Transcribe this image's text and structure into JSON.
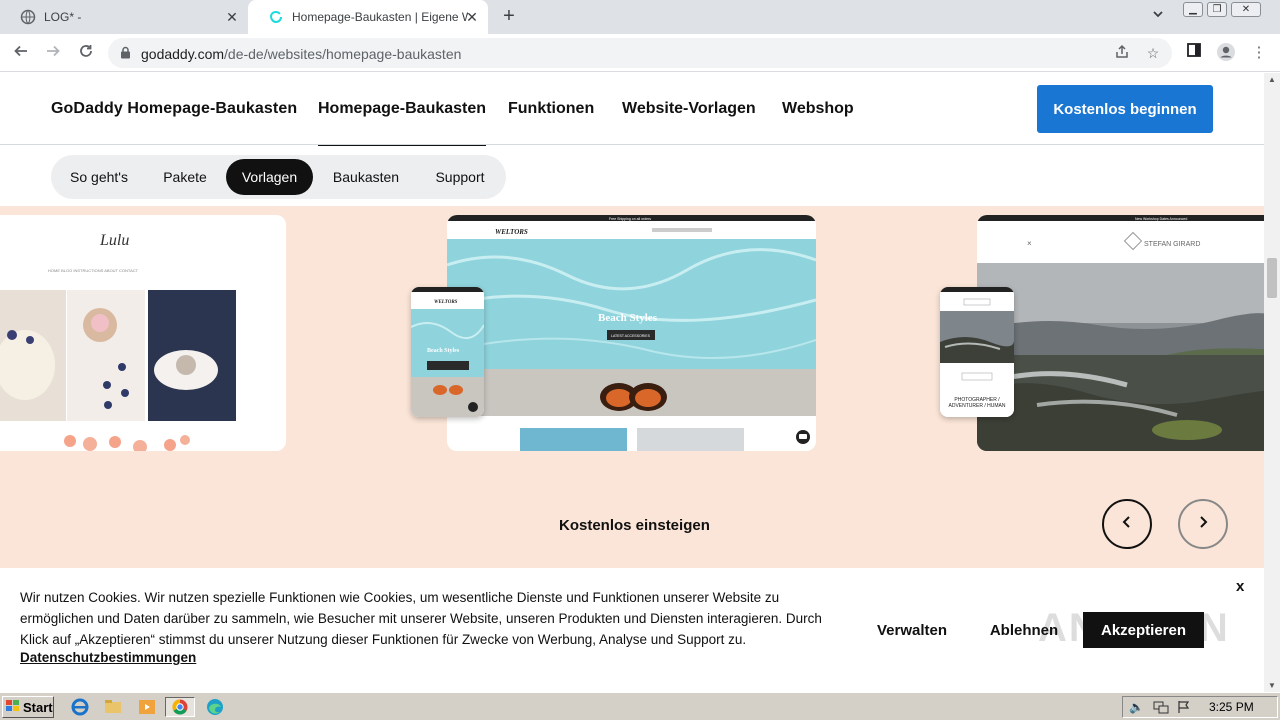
{
  "browser": {
    "tabs": [
      {
        "title": "LOG* -"
      },
      {
        "title": "Homepage-Baukasten | Eigene Website erstellen"
      }
    ],
    "url_host": "godaddy.com",
    "url_path": "/de-de/websites/homepage-baukasten"
  },
  "nav": {
    "brand": "GoDaddy Homepage-Baukasten",
    "links": [
      "Homepage-Baukasten",
      "Funktionen",
      "Website-Vorlagen",
      "Webshop"
    ],
    "cta": "Kostenlos beginnen"
  },
  "subnav": [
    "So geht's",
    "Pakete",
    "Vorlagen",
    "Baukasten",
    "Support"
  ],
  "hero": {
    "templates": {
      "lulu_logo": "Lulu",
      "lulu_menu": "HOME   BLOG   INSTRUCTIONS   ABOUT   CONTACT",
      "beach_logo": "WELTORS",
      "beach_headline": "Beach Styles",
      "beach_button": "LATEST ACCESSORIES",
      "beach_bar": "Free Shipping on all orders",
      "photo_name": "STEFAN GIRARD",
      "photo_bar": "New Workshop Dates Announced",
      "photo_tagline": "PHOTOGRAPHER / ADVENTURER / HUMAN"
    },
    "footer_label": "Kostenlos einsteigen"
  },
  "cookie": {
    "text": "Wir nutzen Cookies. Wir nutzen spezielle Funktionen wie Cookies, um wesentliche Dienste und Funktionen unserer Website zu ermöglichen und Daten darüber zu sammeln, wie Besucher mit unserer Website, unseren Produkten und Diensten interagieren. Durch Klick auf „Akzeptieren“ stimmst du unserer Nutzung dieser Funktionen für Zwecke von Werbung, Analyse und Support zu.",
    "link": "Datenschutzbestimmungen",
    "manage": "Verwalten",
    "decline": "Ablehnen",
    "accept": "Akzeptieren",
    "close": "x",
    "watermark": "ANY.RUN"
  },
  "taskbar": {
    "start": "Start",
    "time": "3:25 PM"
  }
}
